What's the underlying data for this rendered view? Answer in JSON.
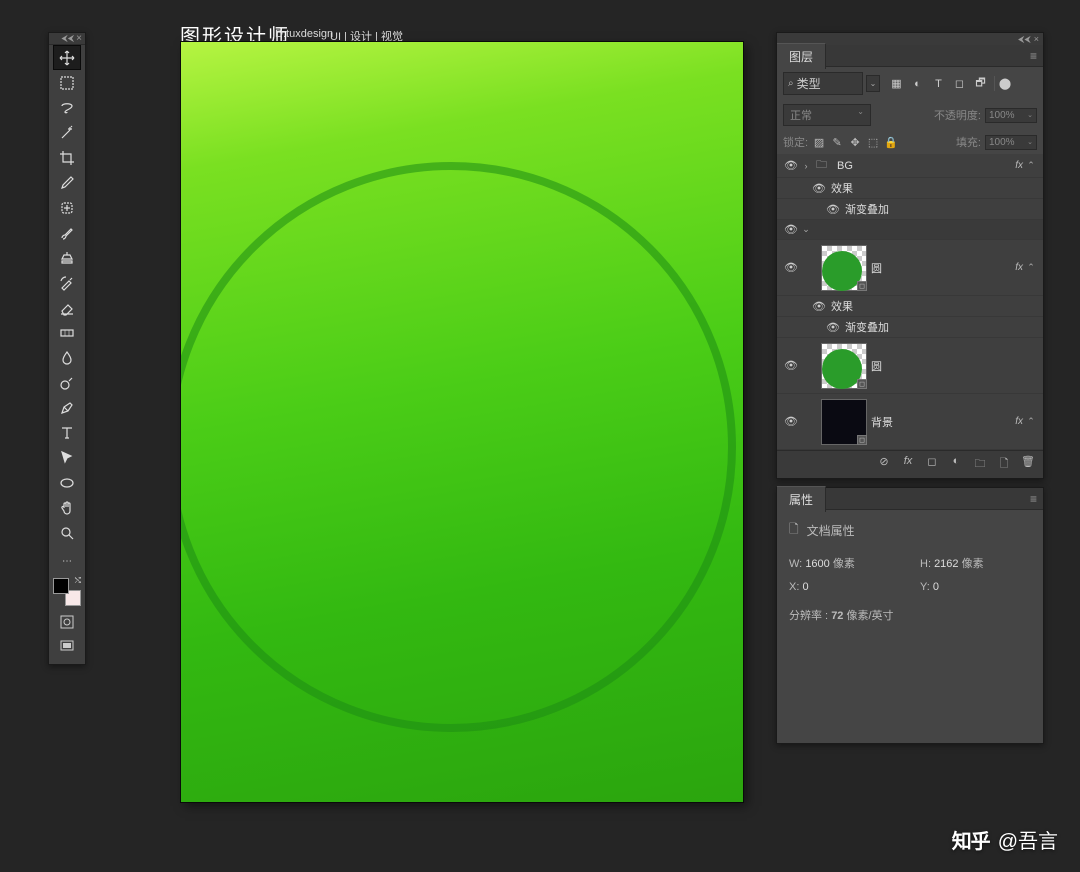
{
  "header": {
    "title": "图形设计师",
    "subtitle": "ID:tuxdesign",
    "tags": "UI | 设计 | 视觉"
  },
  "toolbox": {
    "tools": [
      "move",
      "marquee",
      "lasso",
      "magic-wand",
      "crop",
      "eyedropper",
      "spot-heal",
      "brush",
      "clone",
      "history-brush",
      "eraser",
      "gradient",
      "blur",
      "dodge",
      "pen",
      "type",
      "path-select",
      "ellipse",
      "hand",
      "zoom"
    ],
    "active_index": 0
  },
  "layers_panel": {
    "tab": "图层",
    "filter_label": "类型",
    "blend_mode": "正常",
    "opacity_label": "不透明度:",
    "opacity_value": "100%",
    "lock_label": "锁定:",
    "fill_label": "填充:",
    "fill_value": "100%",
    "items": [
      {
        "type": "group",
        "name": "BG",
        "fx": true,
        "effects_label": "效果",
        "gradient_label": "渐变叠加"
      },
      {
        "type": "selected-header"
      },
      {
        "type": "shape",
        "name": "圆",
        "fx": true,
        "effects_label": "效果",
        "gradient_label": "渐变叠加"
      },
      {
        "type": "shape",
        "name": "圆",
        "fx": false
      },
      {
        "type": "solid",
        "name": "背景",
        "fx": true
      }
    ]
  },
  "properties_panel": {
    "tab": "属性",
    "doc_label": "文档属性",
    "w_label": "W:",
    "w_value": "1600",
    "w_unit": "像素",
    "h_label": "H:",
    "h_value": "2162",
    "h_unit": "像素",
    "x_label": "X:",
    "x_value": "0",
    "y_label": "Y:",
    "y_value": "0",
    "res_label": "分辨率 :",
    "res_value": "72",
    "res_unit": "像素/英寸"
  },
  "watermark": {
    "logo": "知乎",
    "text": "@吾言"
  }
}
